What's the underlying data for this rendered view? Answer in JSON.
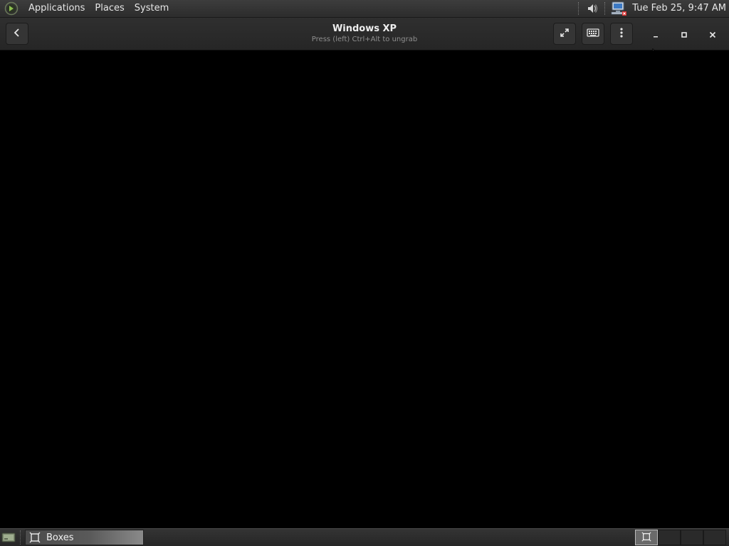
{
  "top_panel": {
    "menus": [
      "Applications",
      "Places",
      "System"
    ],
    "clock": "Tue Feb 25,  9:47 AM",
    "tray_icons": [
      "volume-icon",
      "network-icon"
    ]
  },
  "headerbar": {
    "title": "Windows XP",
    "subtitle": "Press (left) Ctrl+Alt to ungrab",
    "buttons": [
      "back-icon",
      "fullscreen-icon",
      "keyboard-icon",
      "menu-icon"
    ],
    "window_controls": [
      "minimize",
      "maximize",
      "close"
    ]
  },
  "taskbar": {
    "tasks": [
      {
        "label": "Boxes",
        "icon": "boxes-icon",
        "active": true
      }
    ],
    "workspaces": 4,
    "active_workspace": 1
  },
  "colors": {
    "panel_bg": "#2c2c2c",
    "headerbar_bg": "#2a2a2a",
    "display_bg": "#000000",
    "logo_green": "#7ebc4a"
  }
}
